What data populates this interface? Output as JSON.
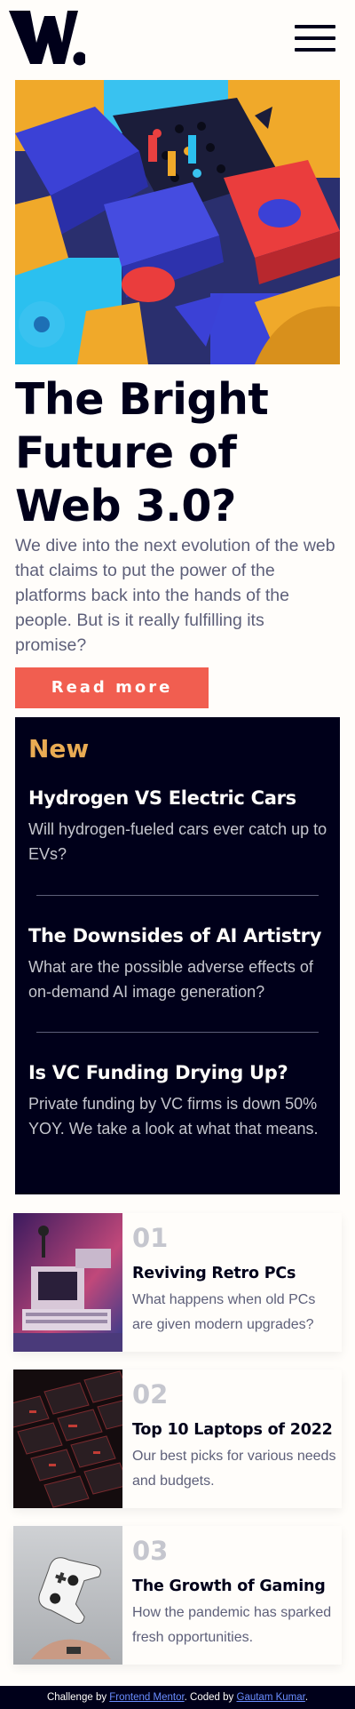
{
  "header": {
    "logo_alt": "W.",
    "menu_icon": "hamburger-menu-icon"
  },
  "hero": {
    "title": "The Bright Future of Web 3.0?",
    "intro": "We dive into the next evolution of the web that claims to put the power of the platforms back into the hands of the people. But is it really fulfilling its promise?",
    "button_label": "Read more"
  },
  "new_section": {
    "title": "New",
    "items": [
      {
        "title": "Hydrogen VS Electric Cars",
        "description": "Will hydrogen-fueled cars ever catch up to EVs?"
      },
      {
        "title": "The Downsides of AI Artistry",
        "description": "What are the possible adverse effects of on-demand AI image generation?"
      },
      {
        "title": "Is VC Funding Drying Up?",
        "description": "Private funding by VC firms is down 50% YOY. We take a look at what that means."
      }
    ]
  },
  "cards": [
    {
      "number": "01",
      "title": "Reviving Retro PCs",
      "description": "What happens when old PCs are given modern upgrades?"
    },
    {
      "number": "02",
      "title": "Top 10 Laptops of 2022",
      "description": "Our best picks for various needs and budgets."
    },
    {
      "number": "03",
      "title": "The Growth of Gaming",
      "description": "How the pandemic has sparked fresh opportunities."
    }
  ],
  "footer": {
    "prefix": "Challenge by ",
    "challenge_link": "Frontend Mentor",
    "middle": ". Coded by ",
    "author_link": "Gautam Kumar",
    "suffix": "."
  },
  "colors": {
    "accent": "#f15e50",
    "dark": "#00001a",
    "gold": "#e9ab53",
    "grey": "#5d5f79",
    "background": "#fffdfa"
  }
}
